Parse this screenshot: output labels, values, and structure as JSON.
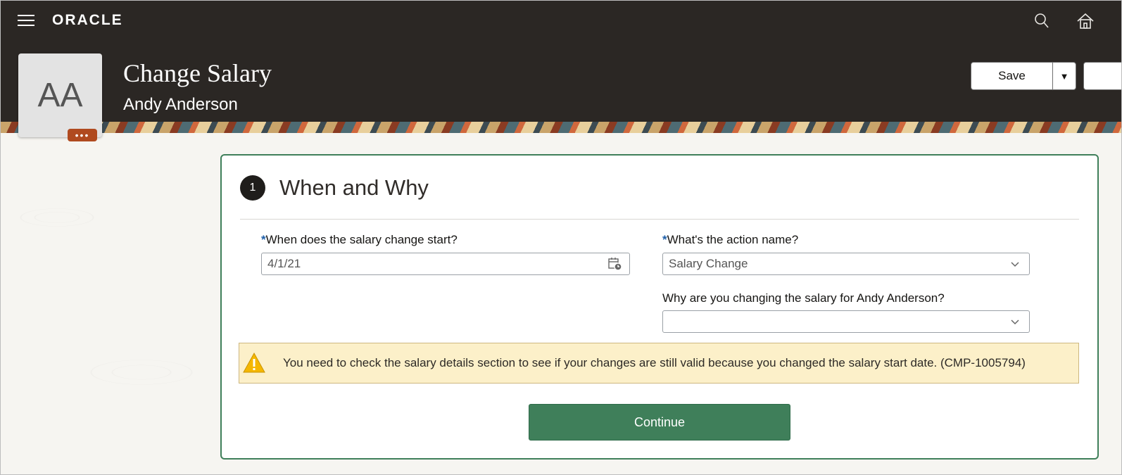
{
  "app": {
    "logo": "ORACLE"
  },
  "header": {
    "title": "Change Salary",
    "subtitle": "Andy Anderson",
    "avatar_initials": "AA",
    "save_label": "Save"
  },
  "step": {
    "number": "1",
    "title": "When and Why"
  },
  "fields": {
    "start_date": {
      "required": "*",
      "label": "When does the salary change start?",
      "value": "4/1/21"
    },
    "action_name": {
      "required": "*",
      "label": "What's the action name?",
      "value": "Salary Change"
    },
    "reason": {
      "label": "Why are you changing the salary for Andy Anderson?",
      "value": ""
    }
  },
  "warning": {
    "text": "You need to check the salary details section to see if your changes are still valid because you changed the salary start date. (CMP-1005794)"
  },
  "continue_label": "Continue",
  "colors": {
    "header": "#2b2724",
    "accent": "#3f7f5a",
    "warning_bg": "#fcf0c9",
    "more_badge": "#b04a1f"
  },
  "icons": [
    "hamburger-icon",
    "search-icon",
    "home-icon",
    "calendar-icon",
    "chevron-down-icon",
    "warning-icon",
    "more-icon"
  ]
}
